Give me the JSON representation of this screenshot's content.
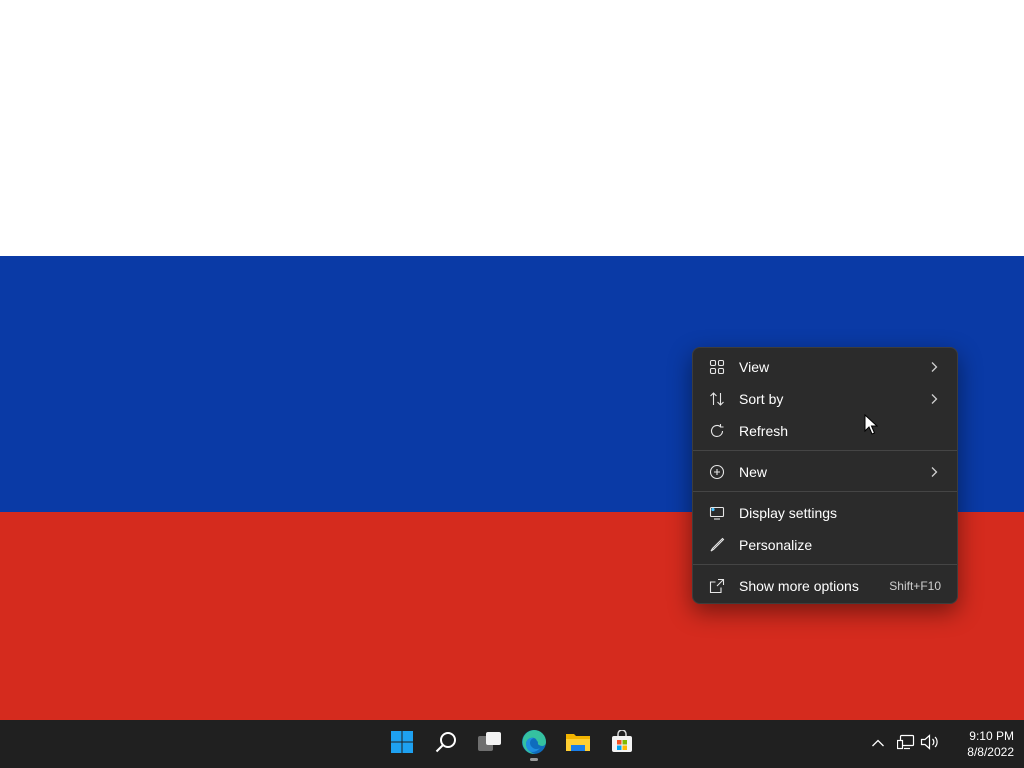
{
  "context_menu": {
    "items": [
      {
        "label": "View",
        "icon": "grid-view-icon",
        "submenu": true
      },
      {
        "label": "Sort by",
        "icon": "sort-arrows-icon",
        "submenu": true
      },
      {
        "label": "Refresh",
        "icon": "refresh-icon",
        "submenu": false
      },
      {
        "label": "New",
        "icon": "plus-circle-icon",
        "submenu": true
      },
      {
        "label": "Display settings",
        "icon": "display-settings-icon",
        "submenu": false
      },
      {
        "label": "Personalize",
        "icon": "pen-brush-icon",
        "submenu": false
      },
      {
        "label": "Show more options",
        "icon": "open-external-icon",
        "shortcut": "Shift+F10"
      }
    ]
  },
  "taskbar": {
    "apps": [
      {
        "name": "Start",
        "icon": "windows-start-icon"
      },
      {
        "name": "Search",
        "icon": "search-icon"
      },
      {
        "name": "Task View",
        "icon": "task-view-icon"
      },
      {
        "name": "Microsoft Edge",
        "icon": "edge-browser-icon",
        "running": true
      },
      {
        "name": "File Explorer",
        "icon": "folder-icon"
      },
      {
        "name": "Microsoft Store",
        "icon": "store-icon"
      }
    ],
    "tray": {
      "icons": [
        "chevron-up-icon",
        "network-icon",
        "volume-icon"
      ],
      "time": "9:10 PM",
      "date": "8/8/2022"
    }
  },
  "colors": {
    "flag_white": "#ffffff",
    "flag_blue": "#0a3aa6",
    "flag_red": "#d52b1e",
    "menu_bg": "#2b2b2b",
    "taskbar_bg": "#202020"
  }
}
